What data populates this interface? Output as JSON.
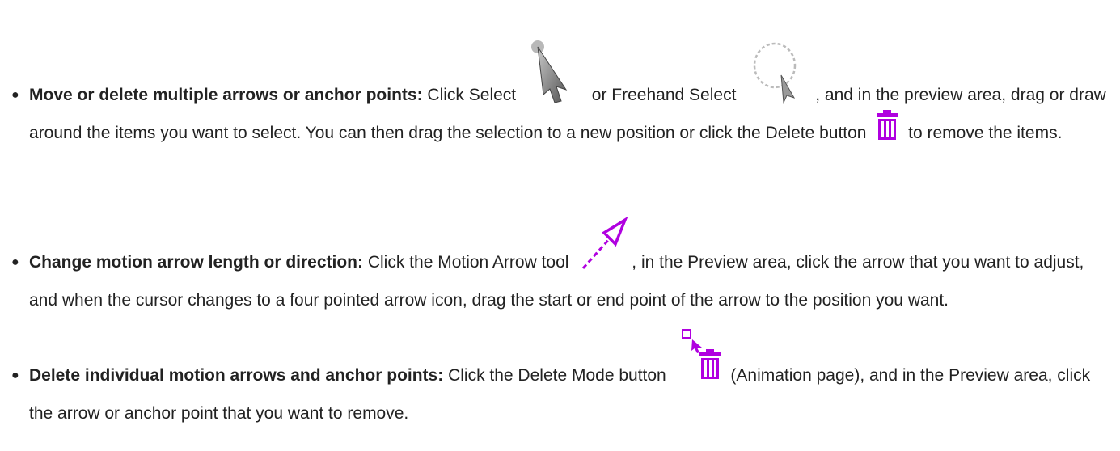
{
  "items": [
    {
      "term": "Move or delete multiple arrows or anchor points:",
      "t1": " Click Select ",
      "icon1": "select-arrow-icon",
      "t2": " or Freehand Select ",
      "icon2": "freehand-select-icon",
      "t3": ", and in the preview area, drag or draw around the items you want to select. You can then drag the selection to a new position or click the Delete button ",
      "icon3": "trash-icon",
      "t4": " to remove the items."
    },
    {
      "term": "Change motion arrow length or direction:",
      "t1": " Click the Motion Arrow tool ",
      "icon1": "motion-arrow-icon",
      "t2": ", in the Preview area, click the arrow that you want to adjust, and when the cursor changes to a four pointed arrow icon, drag the start or end point of the arrow to the position you want."
    },
    {
      "term": "Delete individual motion arrows and anchor points:",
      "t1": " Click the Delete Mode button ",
      "icon1": "delete-mode-icon",
      "t2": " (Animation page), and in the Preview area, click the arrow or anchor point that you want to remove."
    }
  ],
  "colors": {
    "text": "#222222",
    "accent": "#b000e0"
  }
}
